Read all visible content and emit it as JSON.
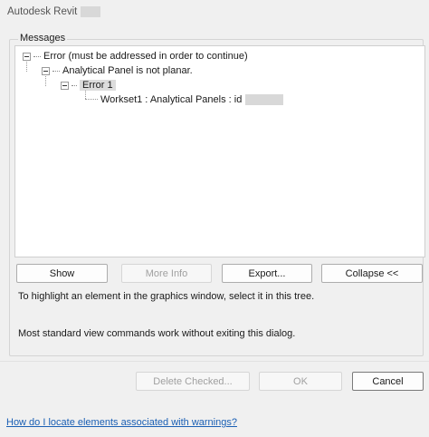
{
  "window": {
    "title": "Autodesk Revit"
  },
  "messages_group": {
    "label": "Messages"
  },
  "tree": {
    "error_node": "Error (must be addressed in order to continue)",
    "panel_node": "Analytical Panel is not planar.",
    "error1_node": "Error 1",
    "element_node": "Workset1 : Analytical Panels : id"
  },
  "buttons": {
    "show": "Show",
    "more_info": "More Info",
    "export": "Export...",
    "collapse": "Collapse <<",
    "delete_checked": "Delete Checked...",
    "ok": "OK",
    "cancel": "Cancel"
  },
  "info": {
    "line1": "To highlight an element in the graphics window, select it in this tree.",
    "line2": "Most standard view commands work without exiting this dialog."
  },
  "help_link": "How do I locate elements associated with warnings?"
}
